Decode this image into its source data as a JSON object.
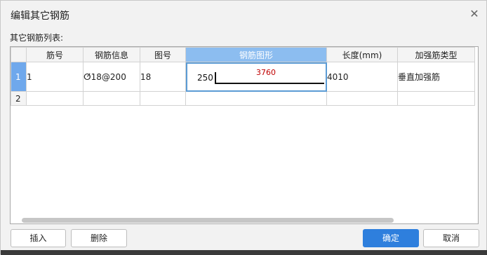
{
  "dialog": {
    "title": "编辑其它钢筋",
    "close_glyph": "✕",
    "list_label": "其它钢筋列表:"
  },
  "table": {
    "headers": {
      "bar_no": "筋号",
      "rebar_info": "钢筋信息",
      "fig_no": "图号",
      "rebar_shape": "钢筋图形",
      "length": "长度(mm)",
      "reinforce_type": "加强筋类型"
    },
    "rows": [
      {
        "num": "1",
        "bar_no": "1",
        "rebar_info": "ⵚ18@200",
        "fig_no": "18",
        "shape_left": "250",
        "shape_top": "3760",
        "length": "4010",
        "reinforce_type": "垂直加强筋"
      },
      {
        "num": "2",
        "bar_no": "",
        "rebar_info": "",
        "fig_no": "",
        "shape_left": "",
        "shape_top": "",
        "length": "",
        "reinforce_type": ""
      }
    ]
  },
  "buttons": {
    "insert": "插入",
    "delete": "删除",
    "ok": "确定",
    "cancel": "取消"
  },
  "colors": {
    "accent": "#2e7fdd",
    "active_header": "#8cbdf0",
    "shape_dim": "#c00000"
  }
}
